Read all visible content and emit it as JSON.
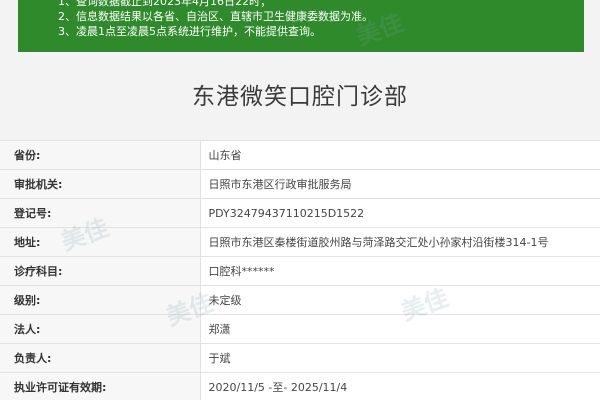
{
  "notice": {
    "lines": [
      "1、查询数据截止到2023年4月16日22时；",
      "2、信息数据结果以各省、自治区、直辖市卫生健康委数据为准。",
      "3、凌晨1点至凌晨5点系统进行维护，不能提供查询。"
    ]
  },
  "title": "东港微笑口腔门诊部",
  "fields": [
    {
      "label": "省份:",
      "value": "山东省"
    },
    {
      "label": "审批机关:",
      "value": "日照市东港区行政审批服务局"
    },
    {
      "label": "登记号:",
      "value": "PDY32479437110215D1522"
    },
    {
      "label": "地址:",
      "value": "日照市东港区秦楼街道胶州路与菏泽路交汇处小孙家村沿街楼314-1号"
    },
    {
      "label": "诊疗科目:",
      "value": "口腔科******"
    },
    {
      "label": "级别:",
      "value": "未定级"
    },
    {
      "label": "法人:",
      "value": "郑潇"
    },
    {
      "label": "负责人:",
      "value": "于斌"
    },
    {
      "label": "执业许可证有效期:",
      "value": "2020/11/5 -至- 2025/11/4"
    }
  ],
  "watermark": "美佳"
}
